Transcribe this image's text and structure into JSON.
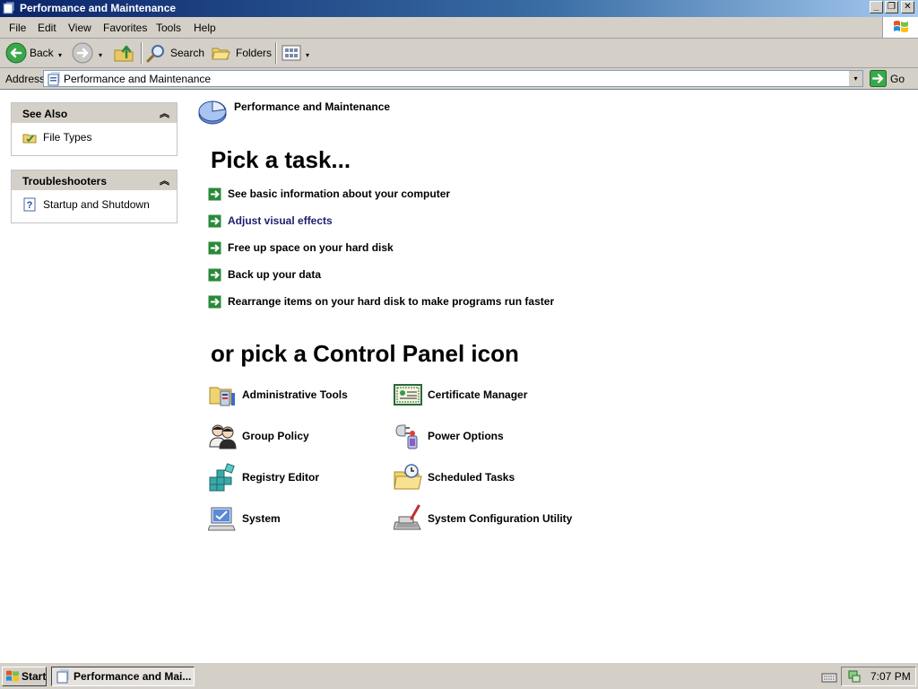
{
  "window": {
    "title": "Performance and Maintenance",
    "controls": {
      "minimize": "_",
      "maximize": "❐",
      "close": "✕"
    }
  },
  "menu": {
    "items": [
      "File",
      "Edit",
      "View",
      "Favorites",
      "Tools",
      "Help"
    ]
  },
  "toolbar": {
    "back_label": "Back",
    "search_label": "Search",
    "folders_label": "Folders",
    "caret": "▾"
  },
  "address": {
    "label": "Address",
    "value": "Performance and Maintenance",
    "go_label": "Go"
  },
  "sidebar": {
    "see_also": {
      "title": "See Also",
      "collapse_glyph": "︽",
      "links": [
        {
          "label": "File Types",
          "icon": "file-types-icon"
        }
      ]
    },
    "troubleshooters": {
      "title": "Troubleshooters",
      "collapse_glyph": "︽",
      "links": [
        {
          "label": "Startup and Shutdown",
          "icon": "help-icon"
        }
      ]
    }
  },
  "main": {
    "category_title": "Performance and Maintenance",
    "pick_task_heading": "Pick a task...",
    "tasks": [
      "See basic information about your computer",
      "Adjust visual effects",
      "Free up space on your hard disk",
      "Back up your data",
      "Rearrange items on your hard disk to make programs run faster"
    ],
    "pick_icon_heading": "or pick a Control Panel icon",
    "icons": [
      {
        "label": "Administrative Tools",
        "icon": "administrative-tools-icon"
      },
      {
        "label": "Certificate Manager",
        "icon": "certificate-icon"
      },
      {
        "label": "Group Policy",
        "icon": "group-policy-icon"
      },
      {
        "label": "Power Options",
        "icon": "power-options-icon"
      },
      {
        "label": "Registry Editor",
        "icon": "registry-editor-icon"
      },
      {
        "label": "Scheduled Tasks",
        "icon": "scheduled-tasks-icon"
      },
      {
        "label": "System",
        "icon": "system-icon"
      },
      {
        "label": "System Configuration Utility",
        "icon": "system-config-icon"
      }
    ]
  },
  "taskbar": {
    "start_label": "Start",
    "active_window_label": "Performance and Mai...",
    "clock": "7:07 PM"
  },
  "colors": {
    "title_gradient_start": "#0a246a",
    "chrome": "#d4d0c8",
    "task_arrow": "#2a8a3a"
  }
}
